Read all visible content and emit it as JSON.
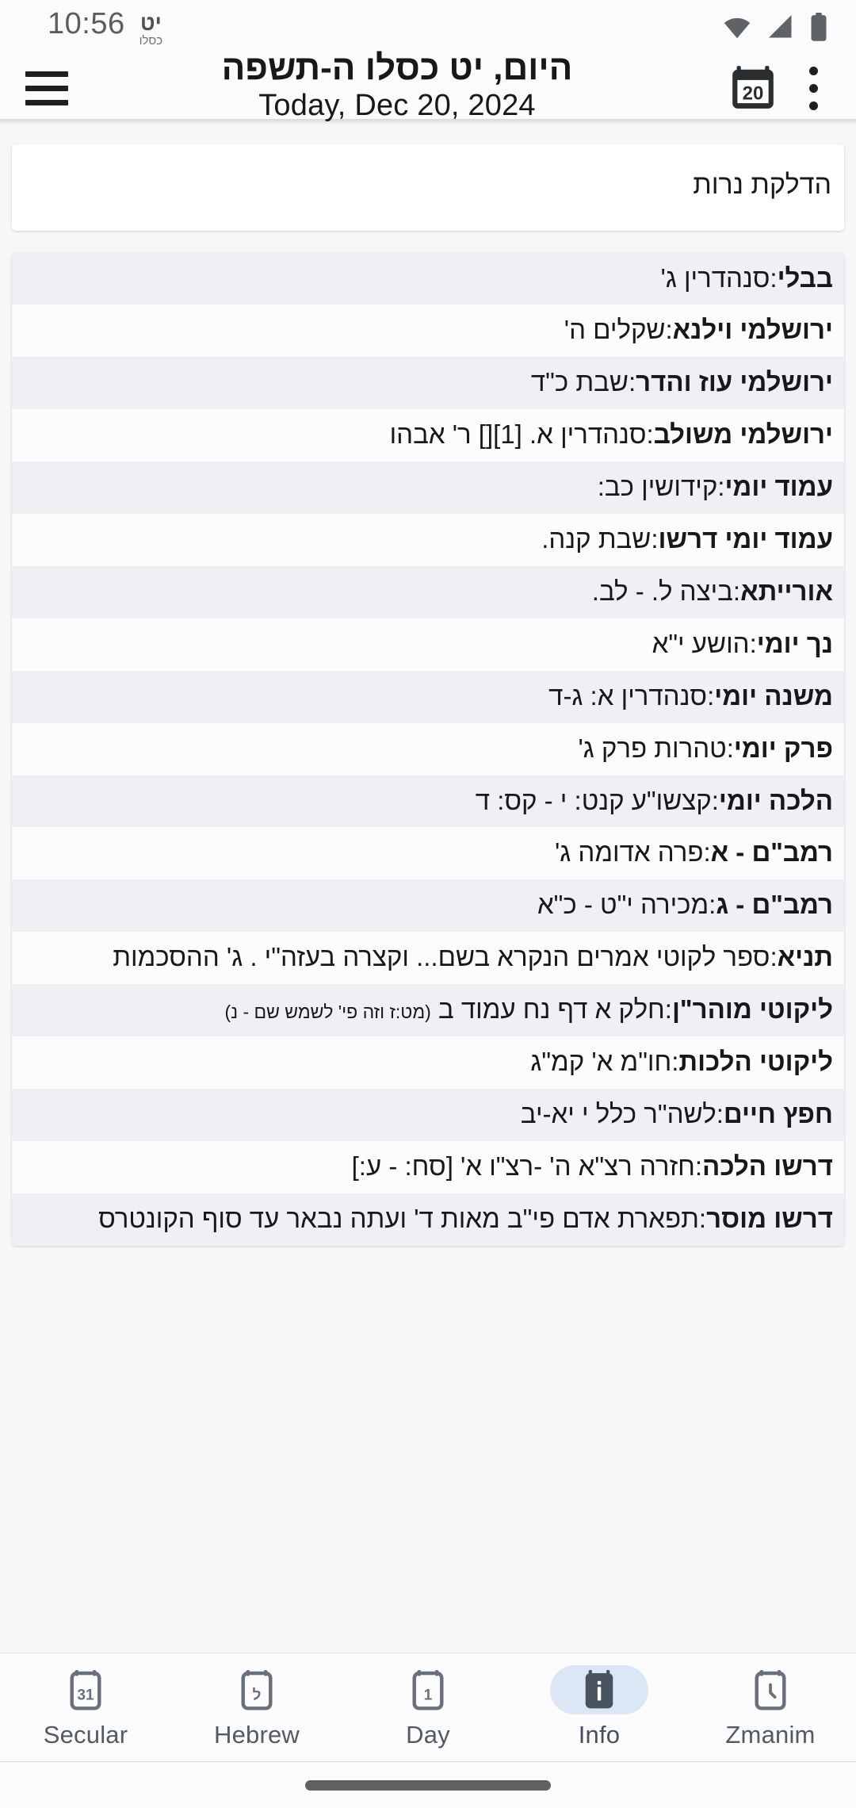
{
  "statusbar": {
    "time": "10:56",
    "hebrew_day": "יט",
    "hebrew_month": "כסלו",
    "icons": [
      "wifi-icon",
      "cellular-signal-icon",
      "battery-icon"
    ]
  },
  "appbar": {
    "menu_icon": "hamburger-menu-icon",
    "title_hebrew": "היום, יט כסלו ה-תשפה",
    "title_english": "Today, Dec 20, 2024",
    "calendar_icon_day": "20",
    "calendar_icon": "calendar-today-icon",
    "overflow_icon": "more-vertical-icon"
  },
  "candle_card": {
    "text": "הדלקת נרות"
  },
  "study_list": [
    {
      "label": "בבלי",
      "value": "סנהדרין ג'"
    },
    {
      "label": "ירושלמי וילנא",
      "value": "שקלים ה'"
    },
    {
      "label": "ירושלמי עוז והדר",
      "value": "שבת כ\"ד"
    },
    {
      "label": "ירושלמי משולב",
      "value": "סנהדרין א. [1][] ר' אבהו"
    },
    {
      "label": "עמוד יומי",
      "value": "קידושין כב:"
    },
    {
      "label": "עמוד יומי דרשו",
      "value": "שבת קנה."
    },
    {
      "label": "אורייתא",
      "value": "ביצה ל. - לב."
    },
    {
      "label": "נך יומי",
      "value": "הושע י\"א"
    },
    {
      "label": "משנה יומי",
      "value": "סנהדרין א: ג-ד"
    },
    {
      "label": "פרק יומי",
      "value": "טהרות פרק ג'"
    },
    {
      "label": "הלכה יומי",
      "value": "קצשו\"ע קנט: י - קס: ד"
    },
    {
      "label": "רמב\"ם - א",
      "value": "פרה אדומה ג'"
    },
    {
      "label": "רמב\"ם - ג",
      "value": "מכירה י\"ט - כ\"א"
    },
    {
      "label": "תניא",
      "value": "ספר לקוטי אמרים הנקרא בשם... וקצרה בעזה\"י . ג' ההסכמות"
    },
    {
      "label": "ליקוטי  מוהר\"ן",
      "value": "חלק א דף נח עמוד ב ",
      "note": "(מט:ז וזה פי' לשמש שם - נ)"
    },
    {
      "label": "ליקוטי הלכות",
      "value": "חו\"מ א' קמ\"ג"
    },
    {
      "label": "חפץ חיים",
      "value": "לשה\"ר כלל י יא-יב"
    },
    {
      "label": "דרשו הלכה",
      "value": "חזרה רצ\"א ה' -רצ\"ו א'  [סח: - ע:]"
    },
    {
      "label": "דרשו מוסר",
      "value": "תפארת אדם פי\"ב מאות ד' ועתה נבאר עד סוף הקונטרס"
    }
  ],
  "bottomnav": {
    "items": [
      {
        "label": "Secular",
        "icon": "calendar-31-icon",
        "glyph": "31",
        "active": false
      },
      {
        "label": "Hebrew",
        "icon": "calendar-hebrew-icon",
        "glyph": "ל",
        "active": false
      },
      {
        "label": "Day",
        "icon": "calendar-1-icon",
        "glyph": "1",
        "active": false
      },
      {
        "label": "Info",
        "icon": "calendar-info-icon",
        "glyph": "i",
        "active": true
      },
      {
        "label": "Zmanim",
        "icon": "calendar-clock-icon",
        "glyph": "clock",
        "active": false
      }
    ],
    "active_pill_color": "#dbe7f4",
    "active_icon_color": "#49525f"
  },
  "gesture_bar": {
    "name": "home-indicator"
  }
}
